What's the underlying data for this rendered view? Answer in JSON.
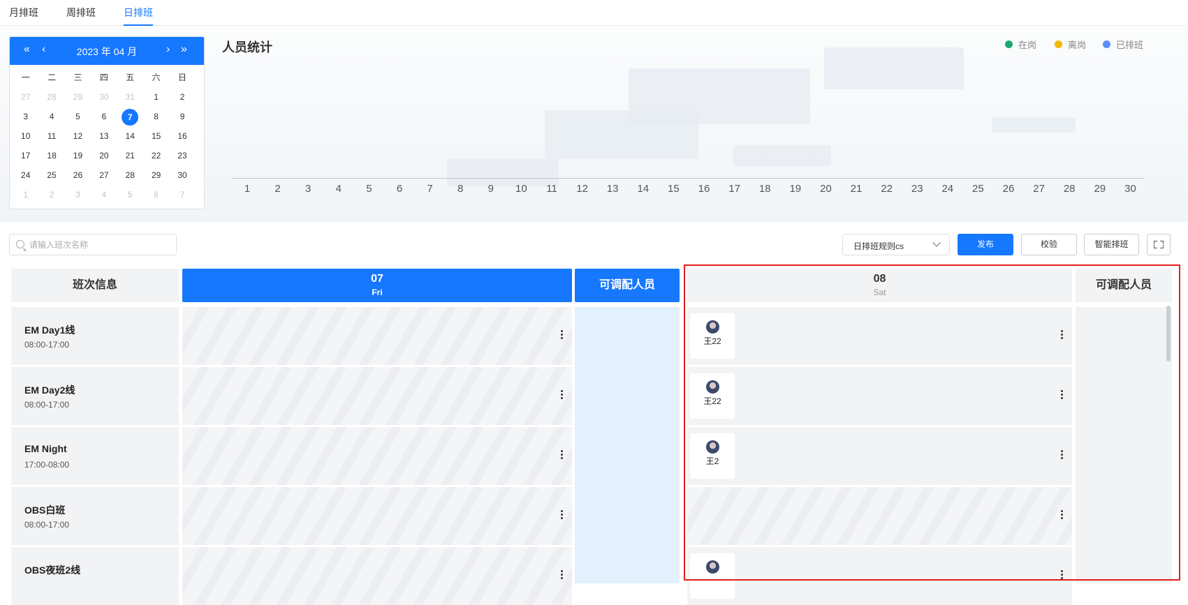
{
  "tabs": [
    {
      "label": "月排班",
      "active": false
    },
    {
      "label": "周排班",
      "active": false
    },
    {
      "label": "日排班",
      "active": true
    }
  ],
  "calendar": {
    "title": "2023 年 04 月",
    "weekdays": [
      "一",
      "二",
      "三",
      "四",
      "五",
      "六",
      "日"
    ],
    "weeks": [
      [
        "27",
        "28",
        "29",
        "30",
        "31",
        "1",
        "2"
      ],
      [
        "3",
        "4",
        "5",
        "6",
        "7",
        "8",
        "9"
      ],
      [
        "10",
        "11",
        "12",
        "13",
        "14",
        "15",
        "16"
      ],
      [
        "17",
        "18",
        "19",
        "20",
        "21",
        "22",
        "23"
      ],
      [
        "24",
        "25",
        "26",
        "27",
        "28",
        "29",
        "30"
      ],
      [
        "1",
        "2",
        "3",
        "4",
        "5",
        "6",
        "7"
      ]
    ],
    "selected": "7"
  },
  "stats": {
    "title": "人员统计",
    "legend": [
      {
        "label": "在岗",
        "color": "#1aa970"
      },
      {
        "label": "离岗",
        "color": "#f5b800"
      },
      {
        "label": "已排班",
        "color": "#5b8ff9"
      }
    ],
    "x_labels": [
      "1",
      "2",
      "3",
      "4",
      "5",
      "6",
      "7",
      "8",
      "9",
      "10",
      "11",
      "12",
      "13",
      "14",
      "15",
      "16",
      "17",
      "18",
      "19",
      "20",
      "21",
      "22",
      "23",
      "24",
      "25",
      "26",
      "27",
      "28",
      "29",
      "30"
    ]
  },
  "toolbar": {
    "search_placeholder": "请输入班次名称",
    "rule_value": "日排班规则cs",
    "publish_label": "发布",
    "check_label": "校验",
    "smart_label": "智能排班"
  },
  "table": {
    "info_header": "班次信息",
    "day1": {
      "day": "07",
      "weekday": "Fri"
    },
    "available_header": "可调配人员",
    "day2": {
      "day": "08",
      "weekday": "Sat"
    },
    "available_header2": "可调配人员",
    "shifts": [
      {
        "name": "EM Day1线",
        "time": "08:00-17:00",
        "day2_person": "王22"
      },
      {
        "name": "EM Day2线",
        "time": "08:00-17:00",
        "day2_person": "王22"
      },
      {
        "name": "EM Night",
        "time": "17:00-08:00",
        "day2_person": "王2"
      },
      {
        "name": "OBS白班",
        "time": "08:00-17:00",
        "day2_person": ""
      },
      {
        "name": "OBS夜班2线",
        "time": "",
        "day2_person": ""
      }
    ]
  }
}
